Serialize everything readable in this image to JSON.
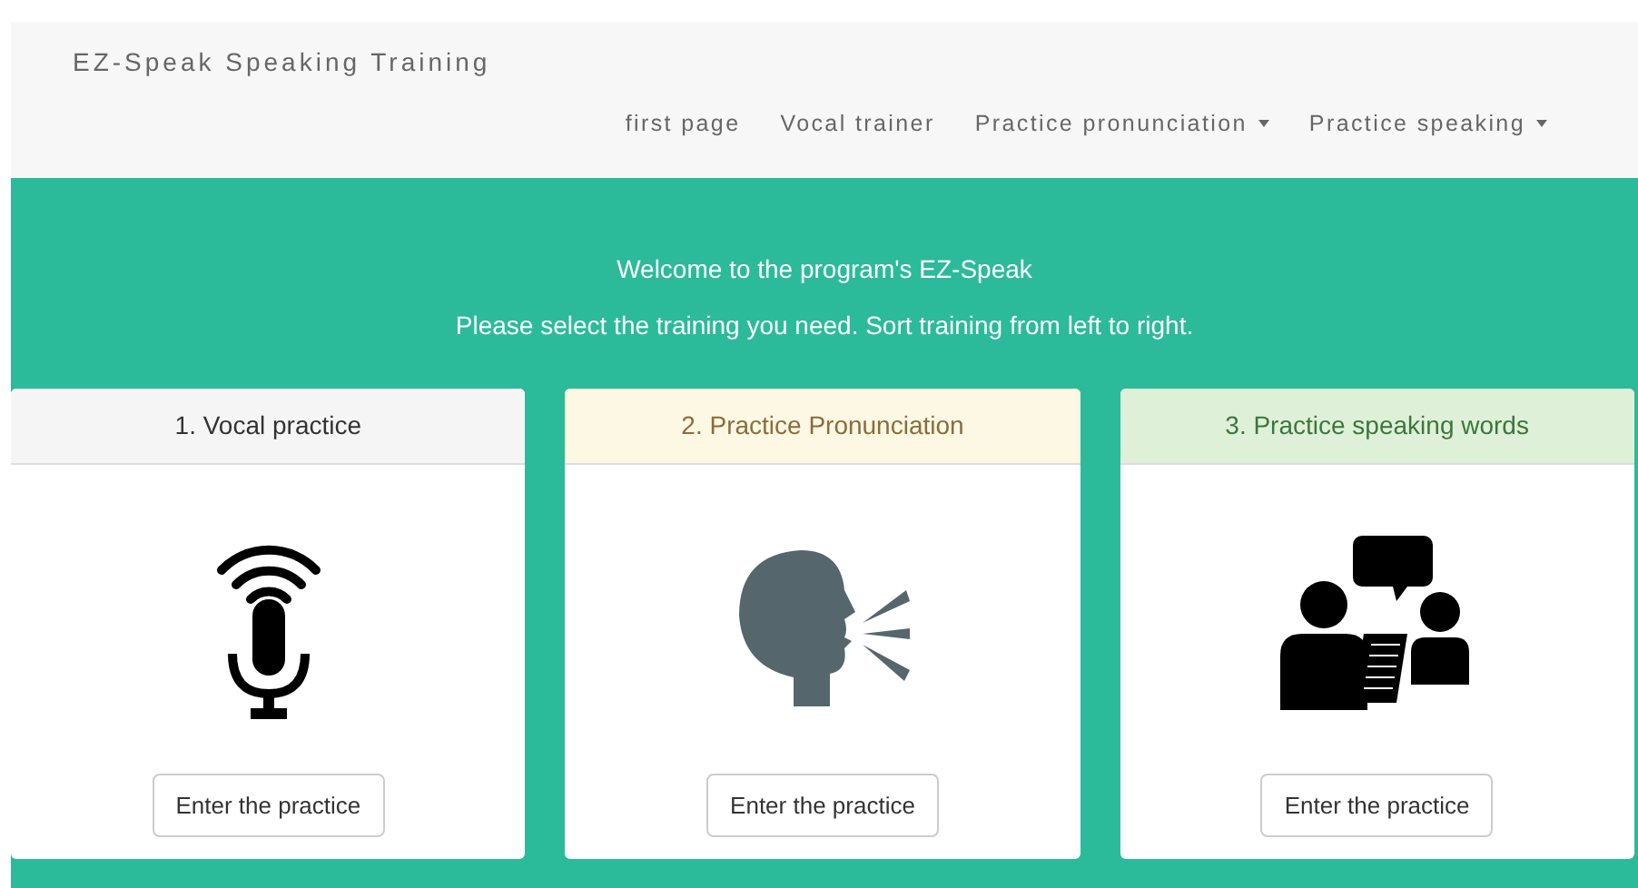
{
  "navbar": {
    "brand": "EZ-Speak Speaking Training",
    "items": [
      {
        "label": "first page",
        "dropdown": false
      },
      {
        "label": "Vocal trainer",
        "dropdown": false
      },
      {
        "label": "Practice pronunciation",
        "dropdown": true
      },
      {
        "label": "Practice speaking",
        "dropdown": true
      }
    ]
  },
  "hero": {
    "title": "Welcome to the program's EZ-Speak",
    "subtitle": "Please select the training you need. Sort training from left to right."
  },
  "cards": [
    {
      "title": "1. Vocal practice",
      "kind": "default",
      "button": "Enter the practice"
    },
    {
      "title": "2. Practice Pronunciation",
      "kind": "warning",
      "button": "Enter the practice"
    },
    {
      "title": "3. Practice speaking words",
      "kind": "success",
      "button": "Enter the practice"
    }
  ]
}
